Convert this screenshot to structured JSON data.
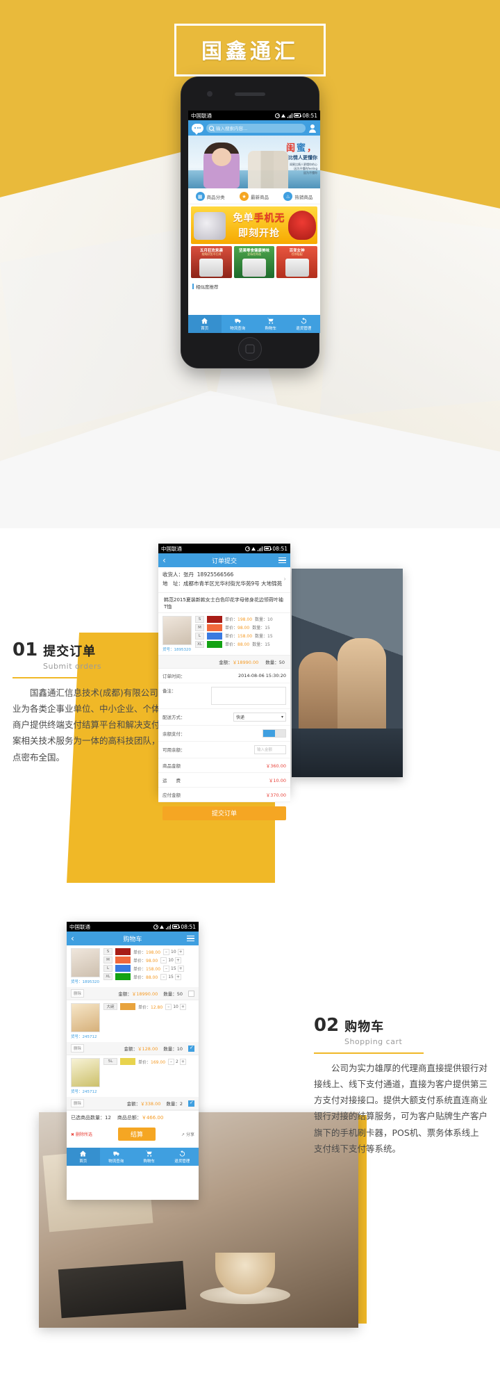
{
  "hero": {
    "logo": "国鑫通汇"
  },
  "phone1": {
    "status": {
      "carrier": "中国联通",
      "time": "08:51"
    },
    "search": {
      "placeholder": "输入搜索内容..."
    },
    "banner": {
      "line1_a": "闺",
      "line1_b": "蜜",
      "line1_c": "，",
      "line2": "比情人更懂你",
      "line3": "闺蜜比情人更懂你的心\n因为不懂的feeling\n因为不懂你"
    },
    "quicknav": [
      {
        "label": "商品分类",
        "icon": "grid-icon",
        "color": "#3f9fe0"
      },
      {
        "label": "最新商品",
        "icon": "new-icon",
        "color": "#f5a623"
      },
      {
        "label": "热销商品",
        "icon": "hot-icon",
        "color": "#3f9fe0"
      }
    ],
    "promo": {
      "line1": "免单",
      "line1_em": "手机无",
      "line2": "即刻开抢"
    },
    "cards": [
      {
        "title": "五月狂欢来袭",
        "sub": "抢购好货不打烊",
        "color": "#d94f3d"
      },
      {
        "title": "坚果零食健康美味",
        "sub": "全场任你选",
        "color": "#4ca64c"
      },
      {
        "title": "百变女神",
        "sub": "任你搭配",
        "color": "#e8553f"
      }
    ],
    "recommend": "相似度推荐",
    "tabs": [
      {
        "label": "首页",
        "icon": "home-icon",
        "active": true
      },
      {
        "label": "物流查询",
        "icon": "truck-icon",
        "active": false
      },
      {
        "label": "购物车",
        "icon": "cart-icon",
        "active": false
      },
      {
        "label": "退货管理",
        "icon": "return-icon",
        "active": false
      }
    ]
  },
  "section2": {
    "number": "01",
    "title": "提交订单",
    "subtitle": "Submit orders",
    "body": "国鑫通汇信息技术(成都)有限公司是专业为各类企事业单位、中小企业、个体工商户提供终端支付结算平台和解决支付方案相关技术服务为一体的高科技团队，网点密布全国。",
    "phone": {
      "status": {
        "carrier": "中国联通",
        "time": "08:51"
      },
      "nav_title": "订单提交",
      "receiver_label": "收货人：",
      "receiver_name": "张丹",
      "receiver_phone": "18925566566",
      "address_label": "地　址：",
      "address": "成都市青羊区光华村街光华苑9号 大地锦苑",
      "product_name": "韩范2015夏装新款女士白色印花字母修身花边领荷叶袖T恤",
      "product_sn": "货号：1895320",
      "size_rows": [
        {
          "size": "S",
          "color": "#a81c16",
          "price_label": "单价：",
          "price": "198.00",
          "qty_label": "数量：",
          "qty": "10"
        },
        {
          "size": "M",
          "color": "#f2693c",
          "price_label": "单价：",
          "price": "98.00",
          "qty_label": "数量：",
          "qty": "15"
        },
        {
          "size": "L",
          "color": "#3a7ae0",
          "price_label": "单价：",
          "price": "158.00",
          "qty_label": "数量：",
          "qty": "15"
        },
        {
          "size": "XL",
          "color": "#13a213",
          "price_label": "单价：",
          "price": "88.00",
          "qty_label": "数量：",
          "qty": "15"
        }
      ],
      "sum_amount_label": "金额：",
      "sum_amount": "￥18990.00",
      "sum_qty_label": "数量：",
      "sum_qty": "50",
      "order_time_label": "订单时间：",
      "order_time": "2014-08-06 15:30:20",
      "note_label": "备注：",
      "shipping_label": "配送方式：",
      "shipping_value": "快递",
      "balance_label": "余额支付：",
      "coupon_placeholder": "输入金额",
      "goods_amount_label": "商品金额",
      "goods_amount": "￥360.00",
      "freight_label": "运　　费",
      "freight": "￥10.00",
      "payable_label": "应付金额",
      "payable": "￥370.00",
      "submit_label": "提交订单"
    }
  },
  "section3": {
    "number": "02",
    "title": "购物车",
    "subtitle": "Shopping cart",
    "body": "公司为实力雄厚的代理商直接提供银行对接线上、线下支付通道，直接为客户提供第三方支付对接接口。提供大额支付系统直连商业银行对接的结算服务，可为客户贴牌生产客户旗下的手机刷卡器，POS机、票务体系线上支付线下支付等系统。",
    "phone": {
      "status": {
        "carrier": "中国联通",
        "time": "08:51"
      },
      "nav_title": "购物车",
      "items": [
        {
          "sn": "货号：1895320",
          "sizes": [
            {
              "size": "S",
              "color": "#a81c16",
              "price_label": "单价：",
              "price": "198.00",
              "qty": "10"
            },
            {
              "size": "M",
              "color": "#f2693c",
              "price_label": "单价：",
              "price": "98.00",
              "qty": "10"
            },
            {
              "size": "L",
              "color": "#3a7ae0",
              "price_label": "单价：",
              "price": "158.00",
              "qty": "15"
            },
            {
              "size": "XL",
              "color": "#13a213",
              "price_label": "单价：",
              "price": "88.00",
              "qty": "15"
            }
          ],
          "delete_label": "删除",
          "amount_label": "金额：",
          "amount": "￥18990.00",
          "qty_label": "数量：",
          "qty": "50",
          "checked": false
        },
        {
          "sn": "货号：245712",
          "sizes": [
            {
              "size": "大碗",
              "color": "#e8a33d",
              "price_label": "单价：",
              "price": "12.80",
              "qty": "10"
            }
          ],
          "delete_label": "删除",
          "amount_label": "金额：",
          "amount": "￥128.00",
          "qty_label": "数量：",
          "qty": "10",
          "checked": true
        },
        {
          "sn": "货号：245712",
          "sizes": [
            {
              "size": "5L",
              "color": "#e8d34d",
              "price_label": "单价：",
              "price": "169.00",
              "qty": "2"
            }
          ],
          "delete_label": "删除",
          "amount_label": "金额：",
          "amount": "￥338.00",
          "qty_label": "数量：",
          "qty": "2",
          "checked": true
        }
      ],
      "total_qty_label": "已选商品数量：",
      "total_qty": "12",
      "total_amount_label": "商品总额：",
      "total_amount": "￥466.00",
      "delete_selected_label": "删除所选",
      "checkout_label": "结算",
      "share_label": "分享",
      "tabs": [
        {
          "label": "首页",
          "icon": "home-icon",
          "active": true
        },
        {
          "label": "物流查询",
          "icon": "truck-icon",
          "active": false
        },
        {
          "label": "购物车",
          "icon": "cart-icon",
          "active": false
        },
        {
          "label": "退货管理",
          "icon": "return-icon",
          "active": false
        }
      ]
    }
  }
}
